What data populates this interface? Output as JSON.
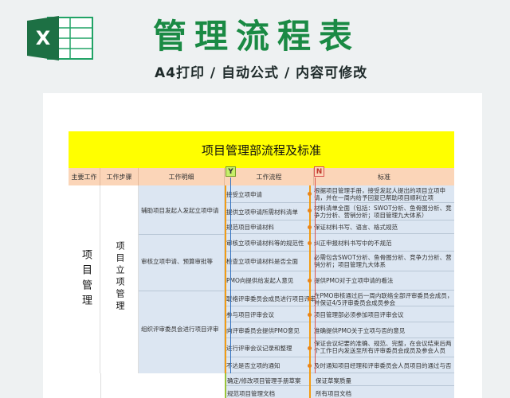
{
  "header": {
    "title": "管理流程表",
    "subtitle": "A4打印 / 自动公式 / 内容可修改",
    "logo_letter": "X"
  },
  "sheet": {
    "banner": "项目管理部流程及标准",
    "columns": [
      "主要工作",
      "工作步骤",
      "工作明细",
      "工作流程",
      "标准"
    ],
    "markers": {
      "y": "Y",
      "n": "N"
    },
    "main_work": "项目管理",
    "step": "项目立项管理",
    "details": [
      "辅助项目发起人发起立项申请",
      "审核立项申请、预算审批等",
      "组织评审委员会进行项目评审"
    ],
    "flows": [
      "接受立项申请",
      "提供立项申请所需材料清单",
      "规范项目申请材料",
      "审核立项申请材料等的规范性",
      "检查立项申请材料是否全面",
      "PMO向提供给发起人意见",
      "联络评审委员会成员进行项目评审",
      "参与项目评审会议",
      "向评审委员会提供PMO意见",
      "进行评审会议记录和整理",
      "不达是否立项的通知"
    ],
    "standards": [
      "根据项目管理手册，接受发起人提出的项目立项申请，并在一周内给予回复已帮助项目顺利立项",
      "材料清单全面（包括：SWOT分析、鱼骨图分析、竞争力分析、营销分析；项目管理九大体系）",
      "保证材料书写、语言、格式规范",
      "纠正申报材料书写中的不规范",
      "必需包含SWOT分析、鱼骨图分析、竞争力分析、营销分析；项目管理九大体系",
      "提供PMO对于立项申请的看法",
      "在PMO审核通过后一周内联络全部评审委员会成员，并保证4/5评审委员会成员参会",
      "项目管理部必须参加项目评审会议",
      "准确提供PMO关于立项与否的意见",
      "保证会议纪要的准确、规范、完整，在会议结束后两个工作日内发送至所有评审委员会成员及参会人员",
      "及时通知项目经理和评审委员会人员项目的通过与否"
    ],
    "next_flows": [
      "确定/修改项目管理手册草案",
      "规范项目管理文档"
    ],
    "next_standards": [
      "保证草案质量",
      "所有项目文档"
    ]
  }
}
